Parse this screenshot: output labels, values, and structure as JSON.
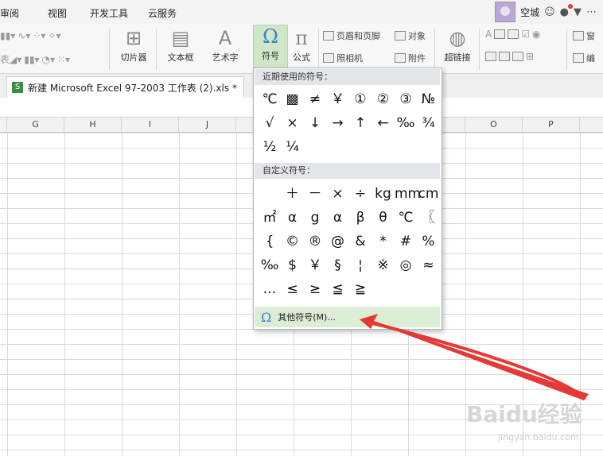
{
  "menubar": {
    "items": [
      "审阅",
      "视图",
      "开发工具",
      "云服务"
    ],
    "username": "空城"
  },
  "ribbon": {
    "slicer_label": "切片器",
    "textbox_label": "文本框",
    "wordart_label": "艺术字",
    "symbol_label": "符号",
    "formula_label": "公式",
    "header_footer_label": "页眉和页脚",
    "object_label": "对象",
    "camera_label": "照相机",
    "attachment_label": "附件",
    "hyperlink_label": "超链接",
    "window_label": "窗",
    "edit_label": "编"
  },
  "tab": {
    "title": "新建 Microsoft Excel 97-2003 工作表 (2).xls *"
  },
  "columns": [
    "G",
    "H",
    "I",
    "J",
    "",
    "",
    "",
    "",
    "O",
    "P"
  ],
  "dropdown": {
    "recent_header": "近期使用的符号：",
    "recent_symbols": [
      "℃",
      "▩",
      "≠",
      "￥",
      "①",
      "②",
      "③",
      "№",
      "√",
      "×",
      "↓",
      "→",
      "↑",
      "←",
      "‰",
      "¾",
      "½",
      "¼"
    ],
    "custom_header": "自定义符号：",
    "custom_symbols": [
      "",
      "＋",
      "－",
      "×",
      "÷",
      "kg",
      "mm",
      "cm",
      "㎡",
      "α",
      "g",
      "α",
      "β",
      "θ",
      "℃",
      "〖",
      "{",
      "©",
      "®",
      "@",
      "&",
      "*",
      "#",
      "%",
      "‰",
      "$",
      "￥",
      "§",
      "¦",
      "※",
      "◎",
      "≈",
      "…",
      "≤",
      "≥",
      "≦",
      "≧"
    ],
    "more_label": "其他符号(M)..."
  },
  "watermark": {
    "brand": "Baidu经验",
    "url": "jingyan.baidu.com"
  },
  "colors": {
    "accent_green": "#cfe6c7",
    "arrow_red": "#e53935"
  }
}
